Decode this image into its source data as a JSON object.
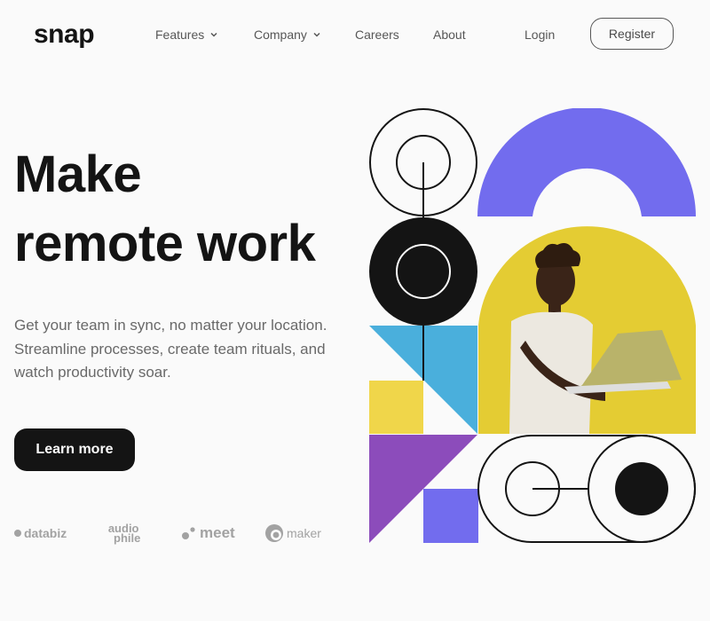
{
  "brand": {
    "name": "snap"
  },
  "nav": {
    "features": "Features",
    "company": "Company",
    "careers": "Careers",
    "about": "About",
    "login": "Login",
    "register": "Register"
  },
  "hero": {
    "title_line1": "Make",
    "title_line2": "remote work",
    "description": "Get your team in sync, no matter your location. Streamline processes, create team rituals, and watch productivity soar.",
    "cta": "Learn more"
  },
  "clients": {
    "databiz": "databiz",
    "audiophile_top": "audio",
    "audiophile_bottom": "phile",
    "meet": "meet",
    "maker": "maker"
  },
  "colors": {
    "ink": "#141414",
    "muted": "#696969",
    "accent_purple": "#726cee",
    "yellow": "#f0d64a",
    "blue": "#4aafdc",
    "violet": "#8c4cbb"
  }
}
